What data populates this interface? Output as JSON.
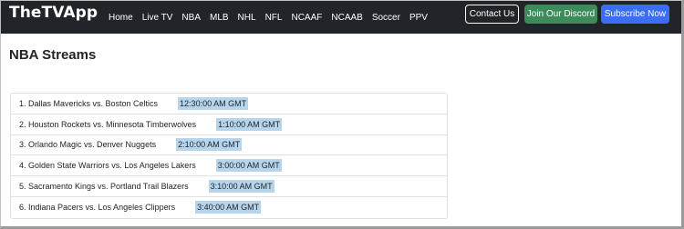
{
  "navbar": {
    "brand": "TheTVApp",
    "links": [
      "Home",
      "Live TV",
      "NBA",
      "MLB",
      "NHL",
      "NFL",
      "NCAAF",
      "NCAAB",
      "Soccer",
      "PPV"
    ],
    "contact_label": "Contact Us",
    "discord_label": "Join Our Discord",
    "subscribe_label": "Subscribe Now",
    "colors": {
      "background": "#212529",
      "discord": "#3d8b5a",
      "subscribe": "#3b6ef5"
    }
  },
  "main": {
    "title": "NBA Streams",
    "streams": [
      {
        "label": "1. Dallas Mavericks vs. Boston Celtics",
        "time": "12:30:00 AM GMT"
      },
      {
        "label": "2. Houston Rockets vs. Minnesota Timberwolves",
        "time": "1:10:00 AM GMT"
      },
      {
        "label": "3. Orlando Magic vs. Denver Nuggets",
        "time": "2:10:00 AM GMT"
      },
      {
        "label": "4. Golden State Warriors vs. Los Angeles Lakers",
        "time": "3:00:00 AM GMT"
      },
      {
        "label": "5. Sacramento Kings vs. Portland Trail Blazers",
        "time": "3:10:00 AM GMT"
      },
      {
        "label": "6. Indiana Pacers vs. Los Angeles Clippers",
        "time": "3:40:00 AM GMT"
      }
    ],
    "time_highlight_color": "#b6d5ec"
  }
}
